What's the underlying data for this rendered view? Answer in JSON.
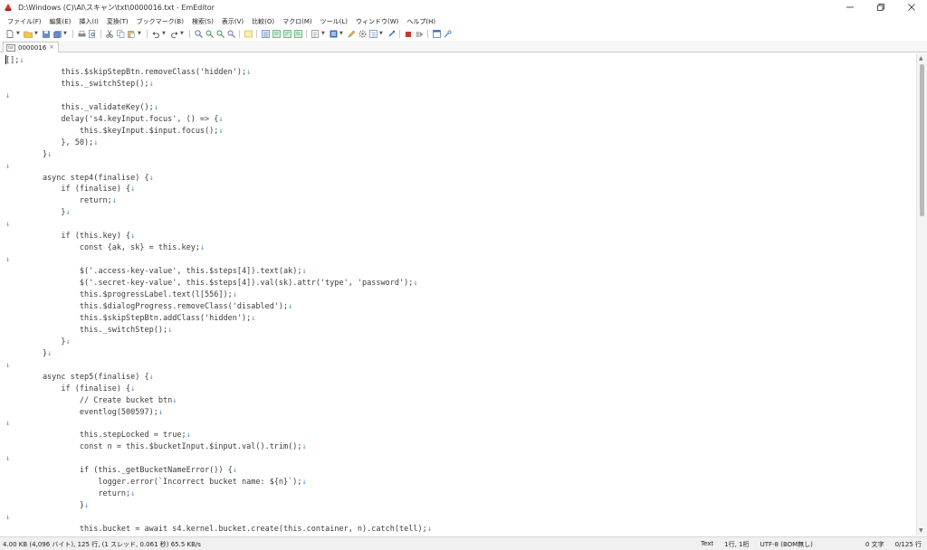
{
  "window": {
    "title": "D:\\Windows (C)\\AI\\スキャン\\txt\\0000016.txt - EmEditor"
  },
  "menu": [
    "ファイル(F)",
    "編集(E)",
    "挿入(I)",
    "変換(T)",
    "ブックマーク(B)",
    "検索(S)",
    "表示(V)",
    "比較(O)",
    "マクロ(M)",
    "ツール(L)",
    "ウィンドウ(W)",
    "ヘルプ(H)"
  ],
  "tab": {
    "icon_text": "txt",
    "label": "0000016",
    "close": "×"
  },
  "editor": {
    "newline_mark": "↓",
    "lines": [
      "[];",
      "            this.$skipStepBtn.removeClass('hidden');",
      "            this._switchStep();",
      "",
      "            this._validateKey();",
      "            delay('s4.keyInput.focus', () => {",
      "                this.$keyInput.$input.focus();",
      "            }, 50);",
      "        }",
      "",
      "        async step4(finalise) {",
      "            if (finalise) {",
      "                return;",
      "            }",
      "",
      "            if (this.key) {",
      "                const {ak, sk} = this.key;",
      "",
      "                $('.access-key-value', this.$steps[4]).text(ak);",
      "                $('.secret-key-value', this.$steps[4]).val(sk).attr('type', 'password');",
      "                this.$progressLabel.text(l[556]);",
      "                this.$dialogProgress.removeClass('disabled');",
      "                this.$skipStepBtn.addClass('hidden');",
      "                this._switchStep();",
      "            }",
      "        }",
      "",
      "        async step5(finalise) {",
      "            if (finalise) {",
      "                // Create bucket btn",
      "                eventlog(500597);",
      "",
      "                this.stepLocked = true;",
      "                const n = this.$bucketInput.$input.val().trim();",
      "",
      "                if (this._getBucketNameError()) {",
      "                    logger.error(`Incorrect bucket name: ${n}`);",
      "                    return;",
      "                }",
      "",
      "                this.bucket = await s4.kernel.bucket.create(this.container, n).catch(tell);"
    ]
  },
  "status": {
    "left": "4.00 KB (4,096 バイト), 125 行, (1 スレッド, 0.061 秒) 65.5 KB/s",
    "encoding_mode": "Text",
    "position": "1行, 1桁",
    "encoding": "UTF-8 (BOM無し)",
    "selection": "0 文字",
    "line_count": "0/125 行"
  },
  "colors": {
    "newline_mark": "#4a90d9",
    "app_icon": "#d9342b"
  }
}
